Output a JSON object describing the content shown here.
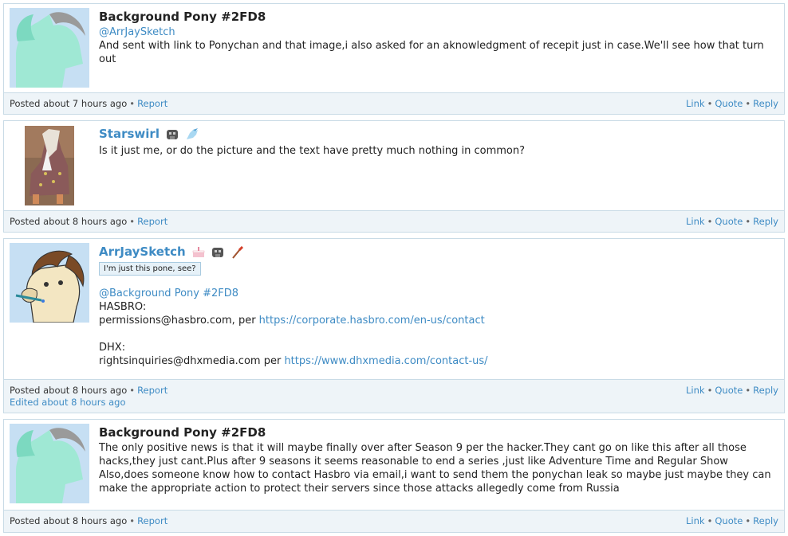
{
  "colors": {
    "accent": "#3e8bc4",
    "footer_bg": "#eef4f8",
    "border": "#c9dbe6"
  },
  "posts": [
    {
      "author": "Background Pony #2FD8",
      "mention": "@ArrJaySketch",
      "text": "And sent with link to Ponychan and that image,i also asked for an aknowledgment of recepit just in case.We'll see how that turn out",
      "posted": "Posted about 7 hours ago",
      "report": "Report",
      "link": "Link",
      "quote": "Quote",
      "reply": "Reply"
    },
    {
      "author": "Starswirl",
      "badges": [
        "elephant-badge-icon",
        "unicorn-badge-icon"
      ],
      "text": "Is it just me, or do the picture and the text have pretty much nothing in common?",
      "posted": "Posted about 8 hours ago",
      "report": "Report",
      "link": "Link",
      "quote": "Quote",
      "reply": "Reply"
    },
    {
      "author": "ArrJaySketch",
      "badges": [
        "cake-badge-icon",
        "elephant-badge-icon",
        "paintbrush-badge-icon"
      ],
      "flair": "I'm just this pone, see?",
      "mention": "@Background Pony #2FD8",
      "line1": "HASBRO:",
      "line2_prefix": "permissions@hasbro.com, per ",
      "line2_url": "https://corporate.hasbro.com/en-us/contact",
      "line3": "DHX:",
      "line4_prefix": "rightsinquiries@dhxmedia.com per ",
      "line4_url": "https://www.dhxmedia.com/contact-us/",
      "posted": "Posted about 8 hours ago",
      "edited": "Edited about 8 hours ago",
      "report": "Report",
      "link": "Link",
      "quote": "Quote",
      "reply": "Reply"
    },
    {
      "author": "Background Pony #2FD8",
      "text": "The only positive news is that it will maybe finally over after Season 9 per the hacker.They cant go on like this after all those hacks,they just cant.Plus after 9 seasons it seems reasonable to end a series ,just like Adventure Time and Regular Show Also,does someone know how to contact Hasbro via email,i want to send them the ponychan leak so maybe just maybe they can make the appropriate action to protect their servers since those attacks allegedly come from Russia",
      "posted": "Posted about 8 hours ago",
      "report": "Report",
      "link": "Link",
      "quote": "Quote",
      "reply": "Reply"
    }
  ]
}
